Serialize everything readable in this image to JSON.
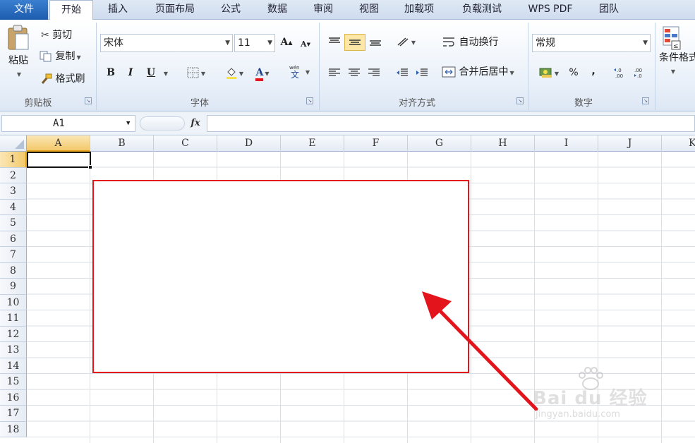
{
  "tabs": [
    "文件",
    "开始",
    "插入",
    "页面布局",
    "公式",
    "数据",
    "审阅",
    "视图",
    "加载项",
    "负载测试",
    "WPS PDF",
    "团队"
  ],
  "clipboard": {
    "paste": "粘贴",
    "cut": "剪切",
    "copy": "复制",
    "format_painter": "格式刷",
    "group": "剪贴板"
  },
  "font": {
    "name": "宋体",
    "size": "11",
    "bold": "B",
    "italic": "I",
    "underline": "U",
    "font_color_letter": "A",
    "group": "字体"
  },
  "alignment": {
    "wrap": "自动换行",
    "merge": "合并后居中",
    "group": "对齐方式"
  },
  "number": {
    "format": "常规",
    "percent": "%",
    "comma": ",",
    "group": "数字"
  },
  "styles": {
    "conditional": "条件格式"
  },
  "formula_bar": {
    "name_box": "A1",
    "fx": "fx"
  },
  "columns": [
    "A",
    "B",
    "C",
    "D",
    "E",
    "F",
    "G",
    "H",
    "I",
    "J",
    "K"
  ],
  "rows": [
    "1",
    "2",
    "3",
    "4",
    "5",
    "6",
    "7",
    "8",
    "9",
    "10",
    "11",
    "12",
    "13",
    "14",
    "15",
    "16",
    "17",
    "18"
  ],
  "watermark": {
    "brand": "Bai du 经验",
    "url": "jingyan.baidu.com"
  },
  "annotation_color": "#e3141c",
  "accent": "#1d5cae"
}
